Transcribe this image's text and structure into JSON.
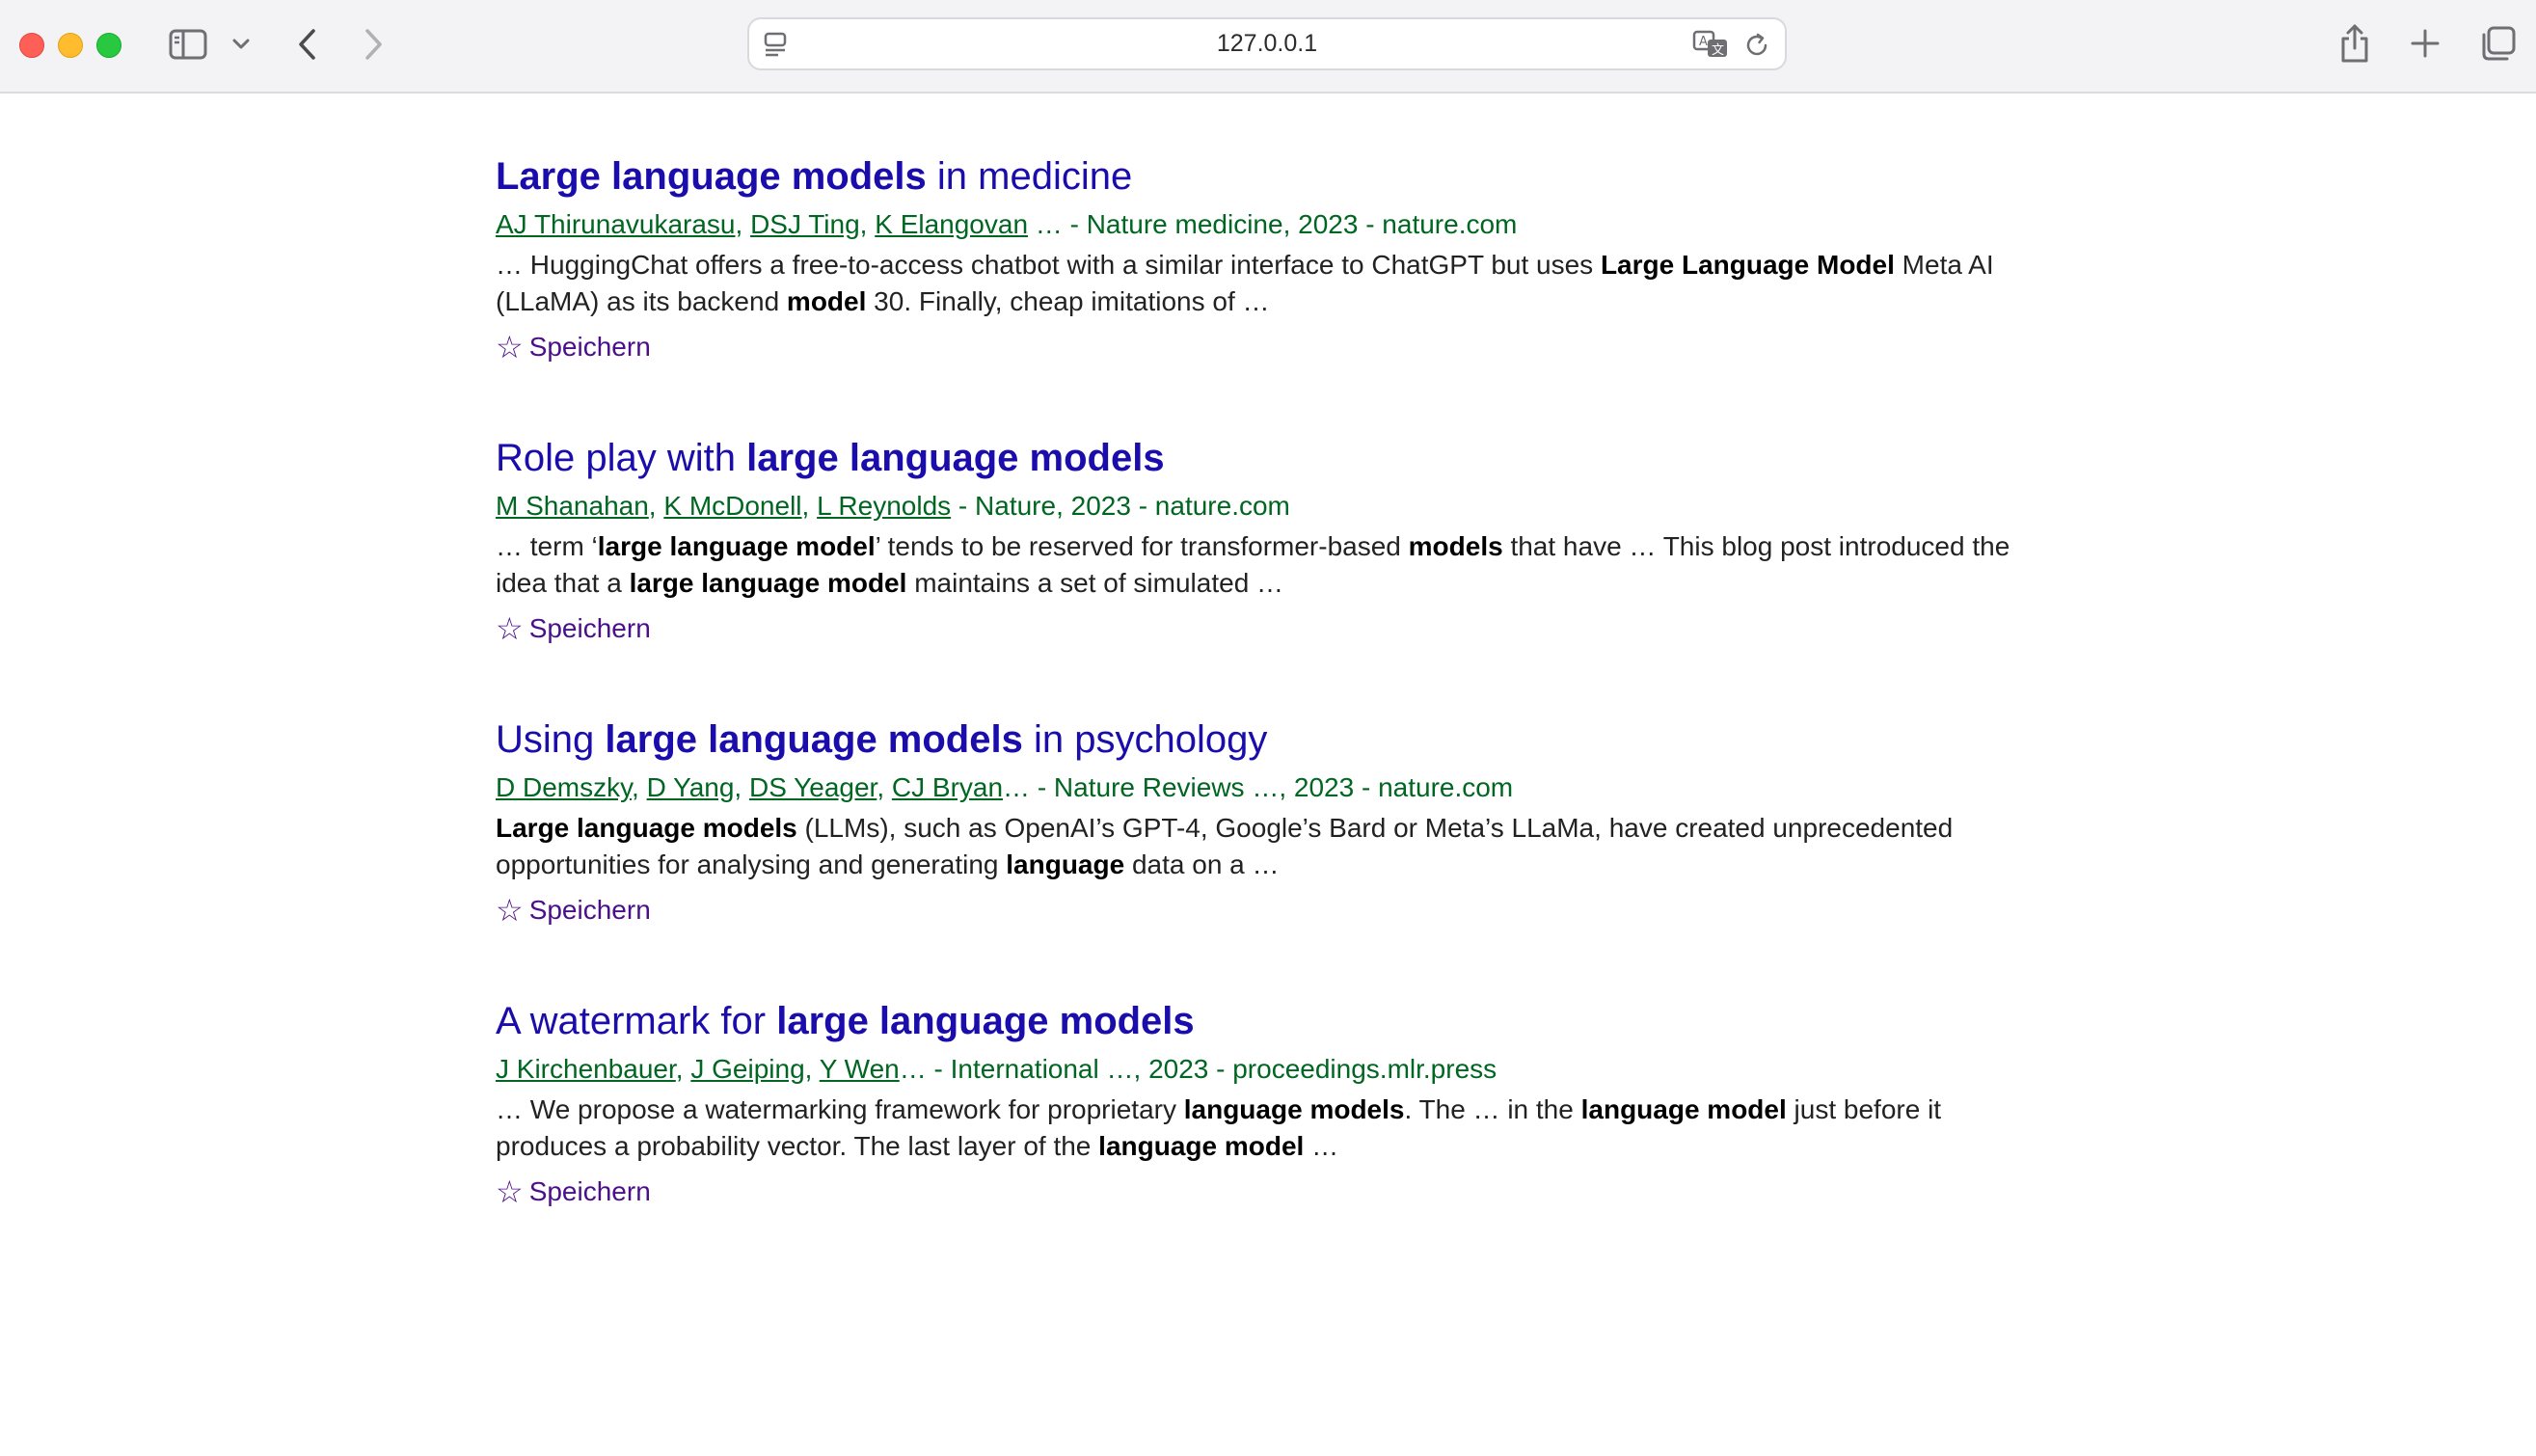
{
  "browser": {
    "url": "127.0.0.1"
  },
  "results": [
    {
      "title_parts": [
        {
          "text": "Large language models",
          "bold": true
        },
        {
          "text": " in medicine",
          "bold": false
        }
      ],
      "authors": [
        "AJ Thirunavukarasu",
        "DSJ Ting",
        "K Elangovan"
      ],
      "meta_suffix": " … - Nature medicine, 2023 - nature.com",
      "snippet_parts": [
        {
          "text": "… HuggingChat offers a free-to-access chatbot with a similar interface to ChatGPT but uses ",
          "bold": false
        },
        {
          "text": "Large Language Model",
          "bold": true
        },
        {
          "text": " Meta AI (LLaMA) as its backend ",
          "bold": false
        },
        {
          "text": "model",
          "bold": true
        },
        {
          "text": " 30. Finally, cheap imitations of …",
          "bold": false
        }
      ],
      "save_label": "Speichern"
    },
    {
      "title_parts": [
        {
          "text": "Role play with ",
          "bold": false
        },
        {
          "text": "large language models",
          "bold": true
        }
      ],
      "authors": [
        "M Shanahan",
        "K McDonell",
        "L Reynolds"
      ],
      "meta_suffix": " - Nature, 2023 - nature.com",
      "snippet_parts": [
        {
          "text": "… term ‘",
          "bold": false
        },
        {
          "text": "large language model",
          "bold": true
        },
        {
          "text": "’ tends to be reserved for transformer-based ",
          "bold": false
        },
        {
          "text": "models",
          "bold": true
        },
        {
          "text": " that have … This blog post introduced the idea that a ",
          "bold": false
        },
        {
          "text": "large language model",
          "bold": true
        },
        {
          "text": " maintains a set of simulated …",
          "bold": false
        }
      ],
      "save_label": "Speichern"
    },
    {
      "title_parts": [
        {
          "text": "Using ",
          "bold": false
        },
        {
          "text": "large language models",
          "bold": true
        },
        {
          "text": " in psychology",
          "bold": false
        }
      ],
      "authors": [
        "D Demszky",
        "D Yang",
        "DS Yeager",
        "CJ Bryan"
      ],
      "meta_suffix": "… - Nature Reviews …, 2023 - nature.com",
      "snippet_parts": [
        {
          "text": "Large language models",
          "bold": true
        },
        {
          "text": " (LLMs), such as OpenAI’s GPT-4, Google’s Bard or Meta’s LLaMa, have created unprecedented opportunities for analysing and generating ",
          "bold": false
        },
        {
          "text": "language",
          "bold": true
        },
        {
          "text": " data on a …",
          "bold": false
        }
      ],
      "save_label": "Speichern"
    },
    {
      "title_parts": [
        {
          "text": "A watermark for ",
          "bold": false
        },
        {
          "text": "large language models",
          "bold": true
        }
      ],
      "authors": [
        "J Kirchenbauer",
        "J Geiping",
        "Y Wen"
      ],
      "meta_suffix": "… - International …, 2023 - proceedings.mlr.press",
      "snippet_parts": [
        {
          "text": "… We propose a watermarking framework for proprietary ",
          "bold": false
        },
        {
          "text": "language models",
          "bold": true
        },
        {
          "text": ". The … in the ",
          "bold": false
        },
        {
          "text": "language model",
          "bold": true
        },
        {
          "text": " just before it produces a probability vector. The last layer of the ",
          "bold": false
        },
        {
          "text": "language model",
          "bold": true
        },
        {
          "text": " …",
          "bold": false
        }
      ],
      "save_label": "Speichern"
    }
  ]
}
